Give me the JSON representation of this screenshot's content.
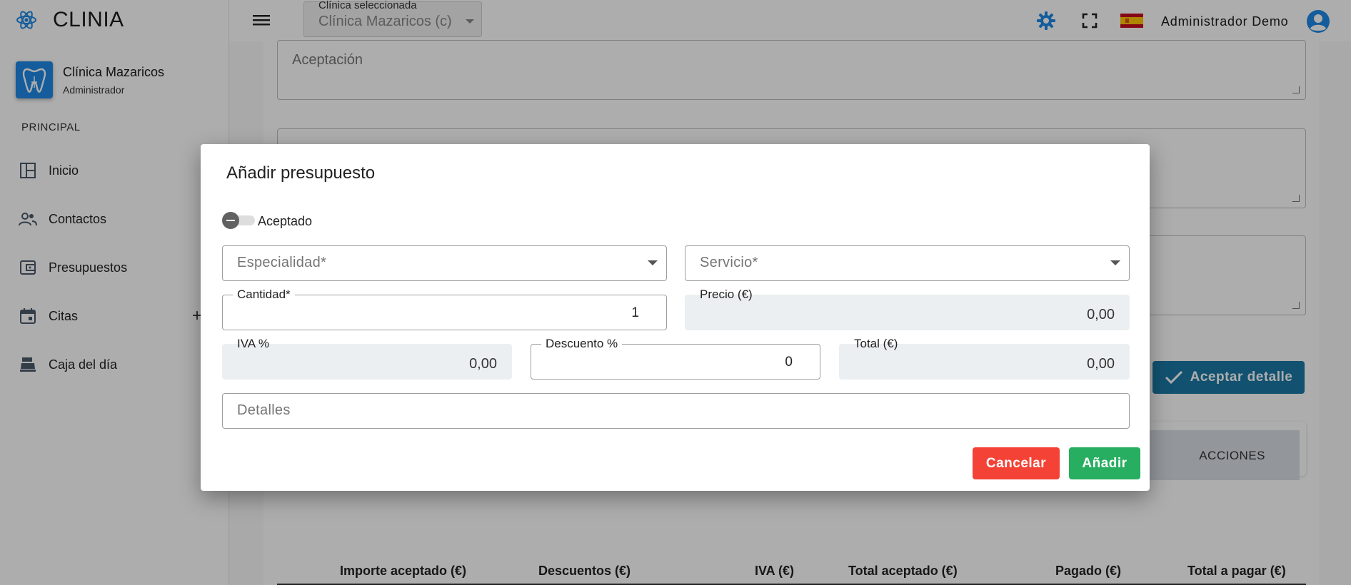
{
  "app": {
    "name": "CLINIA"
  },
  "clinic": {
    "name": "Clínica Mazaricos",
    "role": "Administrador"
  },
  "sidebar": {
    "section": "PRINCIPAL",
    "items": [
      {
        "label": "Inicio",
        "icon": "dashboard-icon"
      },
      {
        "label": "Contactos",
        "icon": "people-icon"
      },
      {
        "label": "Presupuestos",
        "icon": "wallet-icon"
      },
      {
        "label": "Citas",
        "icon": "calendar-icon",
        "extra": "+"
      },
      {
        "label": "Caja del día",
        "icon": "cash-register-icon"
      }
    ]
  },
  "topbar": {
    "clinic_select_label": "Clínica seleccionada",
    "clinic_select_value": "Clínica Mazaricos (c)",
    "user_name": "Administrador Demo",
    "accent": "#1e88e5"
  },
  "background": {
    "textarea_placeholder": "Aceptación",
    "accept_detail_label": "Aceptar detalle",
    "actions_header": "ACCIONES",
    "summary": {
      "importe_aceptado": "Importe aceptado (€)",
      "descuentos": "Descuentos (€)",
      "iva": "IVA (€)",
      "total_aceptado": "Total aceptado (€)",
      "pagado": "Pagado (€)",
      "total_a_pagar": "Total a pagar (€)"
    }
  },
  "modal": {
    "title": "Añadir presupuesto",
    "toggle_label": "Aceptado",
    "especialidad_placeholder": "Especialidad*",
    "servicio_placeholder": "Servicio*",
    "cantidad_label": "Cantidad*",
    "cantidad_value": "1",
    "precio_label": "Precio (€)",
    "precio_value": "0,00",
    "iva_label": "IVA %",
    "iva_value": "0,00",
    "descuento_label": "Descuento %",
    "descuento_value": "0",
    "total_label": "Total (€)",
    "total_value": "0,00",
    "detalles_placeholder": "Detalles",
    "cancel_label": "Cancelar",
    "add_label": "Añadir",
    "colors": {
      "cancel": "#f44336",
      "add": "#27ae60"
    }
  }
}
